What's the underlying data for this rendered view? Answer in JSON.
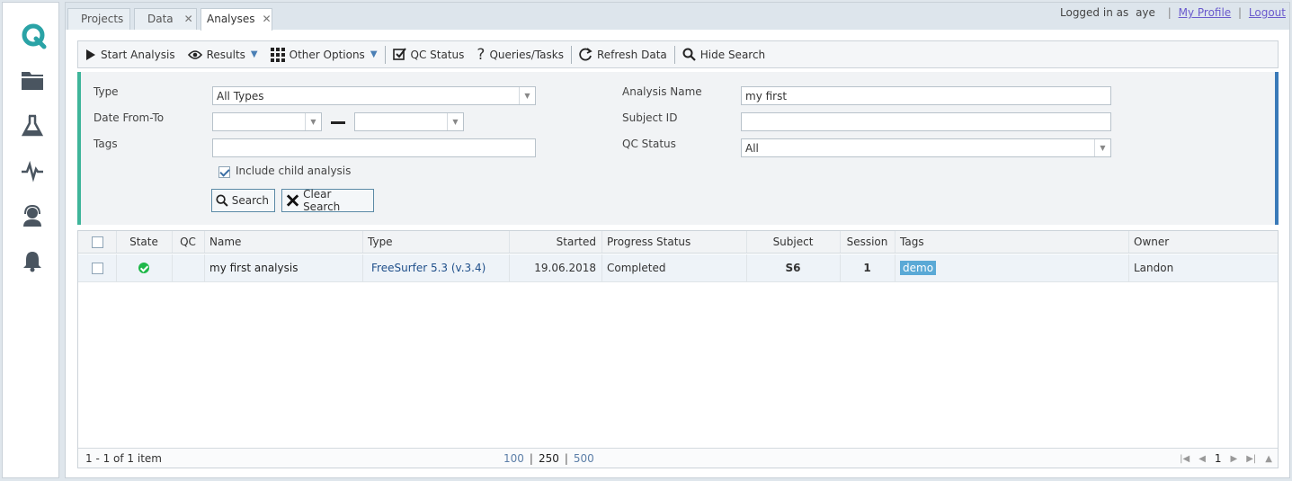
{
  "tabs": [
    {
      "label": "Projects",
      "closable": false
    },
    {
      "label": "Data",
      "closable": true
    },
    {
      "label": "Analyses",
      "closable": true,
      "active": true
    }
  ],
  "user": {
    "logged_in_as": "Logged in as",
    "username": "aye",
    "my_profile": "My Profile",
    "logout": "Logout"
  },
  "sidebar": {
    "icons": [
      "logo-q-icon",
      "folder-icon",
      "flask-icon",
      "activity-icon",
      "support-icon",
      "bell-icon"
    ]
  },
  "toolbar": {
    "start_analysis": "Start Analysis",
    "results": "Results",
    "other_options": "Other Options",
    "qc_status": "QC Status",
    "queries_tasks": "Queries/Tasks",
    "refresh_data": "Refresh Data",
    "hide_search": "Hide Search"
  },
  "search": {
    "type_label": "Type",
    "type_value": "All Types",
    "date_label": "Date From-To",
    "date_from": "",
    "date_to": "",
    "tags_label": "Tags",
    "tags_value": "",
    "include_child_label": "Include child analysis",
    "include_child_checked": true,
    "analysis_name_label": "Analysis Name",
    "analysis_name_value": "my first",
    "subject_id_label": "Subject ID",
    "subject_id_value": "",
    "qc_status_label": "QC Status",
    "qc_status_value": "All",
    "search_button": "Search",
    "clear_button": "Clear Search"
  },
  "grid": {
    "columns": {
      "state": "State",
      "qc": "QC",
      "name": "Name",
      "type": "Type",
      "started": "Started",
      "progress": "Progress Status",
      "subject": "Subject",
      "session": "Session",
      "tags": "Tags",
      "owner": "Owner"
    },
    "rows": [
      {
        "state": "completed",
        "qc": "",
        "name": "my first analysis",
        "type": "FreeSurfer 5.3 (v.3.4)",
        "started": "19.06.2018",
        "progress": "Completed",
        "subject": "S6",
        "session": "1",
        "tag": "demo",
        "owner": "Landon"
      }
    ],
    "footer": {
      "count": "1 - 1 of 1 item",
      "size_100": "100",
      "size_250": "250",
      "size_500": "500",
      "page": "1"
    }
  },
  "colors": {
    "accent_green": "#3fb59a",
    "accent_blue": "#3a7ab8",
    "status_ok": "#1fb84a",
    "tag_bg": "#5aa9d6",
    "logo": "#2aa3a6"
  }
}
